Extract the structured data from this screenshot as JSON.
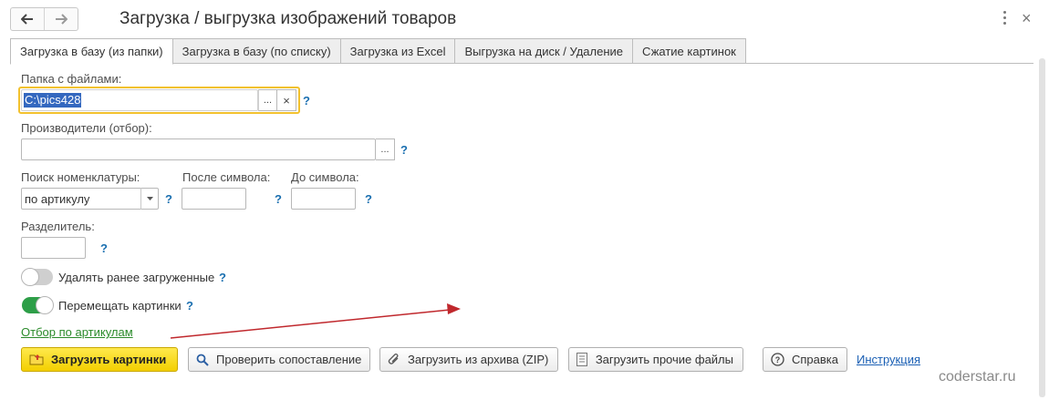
{
  "window": {
    "title": "Загрузка / выгрузка изображений товаров"
  },
  "tabs": [
    {
      "label": "Загрузка в базу (из папки)",
      "active": true
    },
    {
      "label": "Загрузка в базу (по списку)",
      "active": false
    },
    {
      "label": "Загрузка из Excel",
      "active": false
    },
    {
      "label": "Выгрузка на диск / Удаление",
      "active": false
    },
    {
      "label": "Сжатие картинок",
      "active": false
    }
  ],
  "form": {
    "folder": {
      "label": "Папка с файлами:",
      "value": "C:\\pics428",
      "select_btn": "...",
      "clear_btn": "×"
    },
    "manufacturers": {
      "label": "Производители (отбор):",
      "value": "",
      "select_btn": "..."
    },
    "search": {
      "label": "Поиск номенклатуры:",
      "value": "по артикулу"
    },
    "after_symbol": {
      "label": "После символа:",
      "value": ""
    },
    "to_symbol": {
      "label": "До символа:",
      "value": ""
    },
    "separator": {
      "label": "Разделитель:",
      "value": ""
    },
    "delete_loaded": {
      "label": "Удалять ранее загруженные",
      "checked": false
    },
    "move_images": {
      "label": "Перемещать картинки",
      "checked": true
    },
    "filter_link": "Отбор по артикулам",
    "help": "?"
  },
  "buttons": {
    "load_images": "Загрузить картинки",
    "check_match": "Проверить сопоставление",
    "load_zip": "Загрузить из архива (ZIP)",
    "load_other": "Загрузить прочие файлы",
    "help": "Справка",
    "instruction": "Инструкция"
  },
  "watermark": "coderstar.ru",
  "colors": {
    "accent_yellow": "#f3cf00",
    "focus_border": "#f2c12e",
    "toggle_on": "#2d9e48",
    "help_blue": "#1a6fb0",
    "arrow_red": "#c0282d"
  }
}
